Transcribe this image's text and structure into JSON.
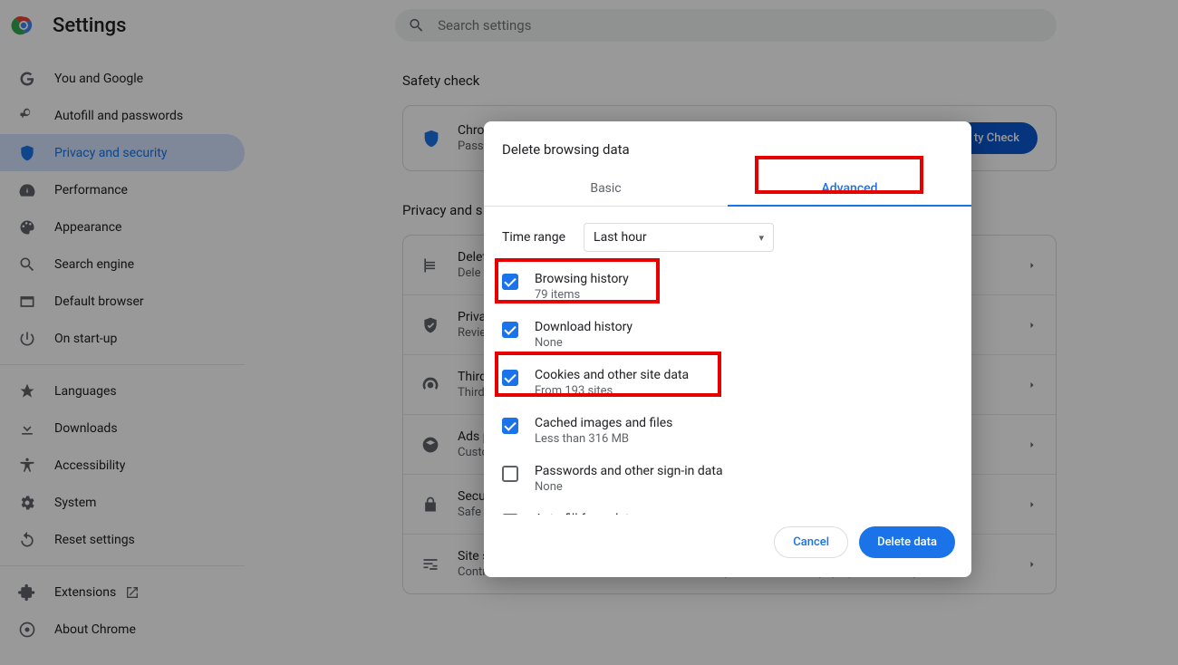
{
  "app": {
    "title": "Settings",
    "search_placeholder": "Search settings"
  },
  "sidebar": {
    "items": [
      {
        "label": "You and Google"
      },
      {
        "label": "Autofill and passwords"
      },
      {
        "label": "Privacy and security"
      },
      {
        "label": "Performance"
      },
      {
        "label": "Appearance"
      },
      {
        "label": "Search engine"
      },
      {
        "label": "Default browser"
      },
      {
        "label": "On start-up"
      }
    ],
    "items2": [
      {
        "label": "Languages"
      },
      {
        "label": "Downloads"
      },
      {
        "label": "Accessibility"
      },
      {
        "label": "System"
      },
      {
        "label": "Reset settings"
      }
    ],
    "items3": [
      {
        "label": "Extensions"
      },
      {
        "label": "About Chrome"
      }
    ]
  },
  "content": {
    "safety_title": "Safety check",
    "safety_row_title": "Chro",
    "safety_row_sub": "Passw",
    "safety_button": "ty Check",
    "privacy_title": "Privacy and s",
    "rows": [
      {
        "t1": "Delet",
        "t2": "Dele"
      },
      {
        "t1": "Priva",
        "t2": "Revie"
      },
      {
        "t1": "Third",
        "t2": "Third"
      },
      {
        "t1": "Ads p",
        "t2": "Custo"
      },
      {
        "t1": "Secu",
        "t2": "Safe"
      },
      {
        "t1": "Site s",
        "t2": "Controls what information sites can use and show (location, camera, pop-ups and more)"
      }
    ]
  },
  "dialog": {
    "title": "Delete browsing data",
    "tabs": {
      "basic": "Basic",
      "advanced": "Advanced"
    },
    "time_label": "Time range",
    "time_value": "Last hour",
    "options": [
      {
        "title": "Browsing history",
        "sub": "79 items",
        "checked": true
      },
      {
        "title": "Download history",
        "sub": "None",
        "checked": true
      },
      {
        "title": "Cookies and other site data",
        "sub": "From 193 sites",
        "checked": true
      },
      {
        "title": "Cached images and files",
        "sub": "Less than 316 MB",
        "checked": true
      },
      {
        "title": "Passwords and other sign-in data",
        "sub": "None",
        "checked": false
      },
      {
        "title": "Auto-fill form data",
        "sub": "",
        "checked": false
      }
    ],
    "cancel": "Cancel",
    "delete": "Delete data"
  }
}
